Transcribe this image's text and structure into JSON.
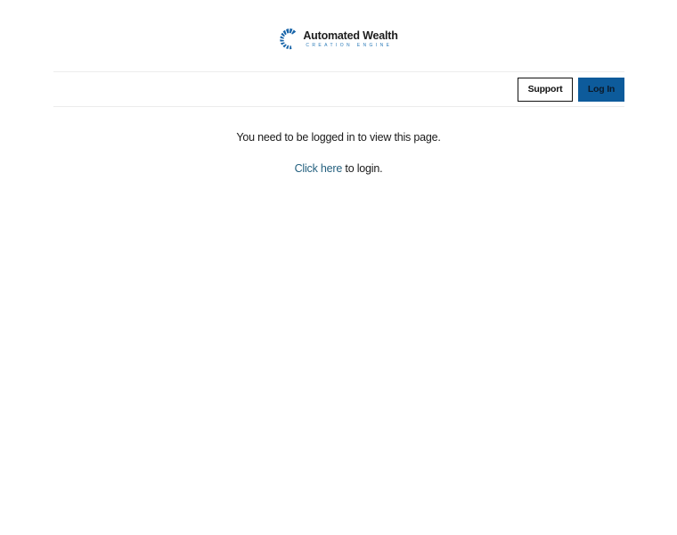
{
  "brand": {
    "name": "Automated Wealth",
    "tagline": "CREATION ENGINE",
    "logo_icon": "segmented-wheel-icon",
    "colors": {
      "primary": "#0d5b9b",
      "accent": "#2a7ab8"
    }
  },
  "nav": {
    "support_label": "Support",
    "login_label": "Log In"
  },
  "notice": {
    "message": "You need to be logged in to view this page.",
    "link_text": "Click here",
    "link_suffix": " to login.",
    "link_color": "#24607f"
  }
}
